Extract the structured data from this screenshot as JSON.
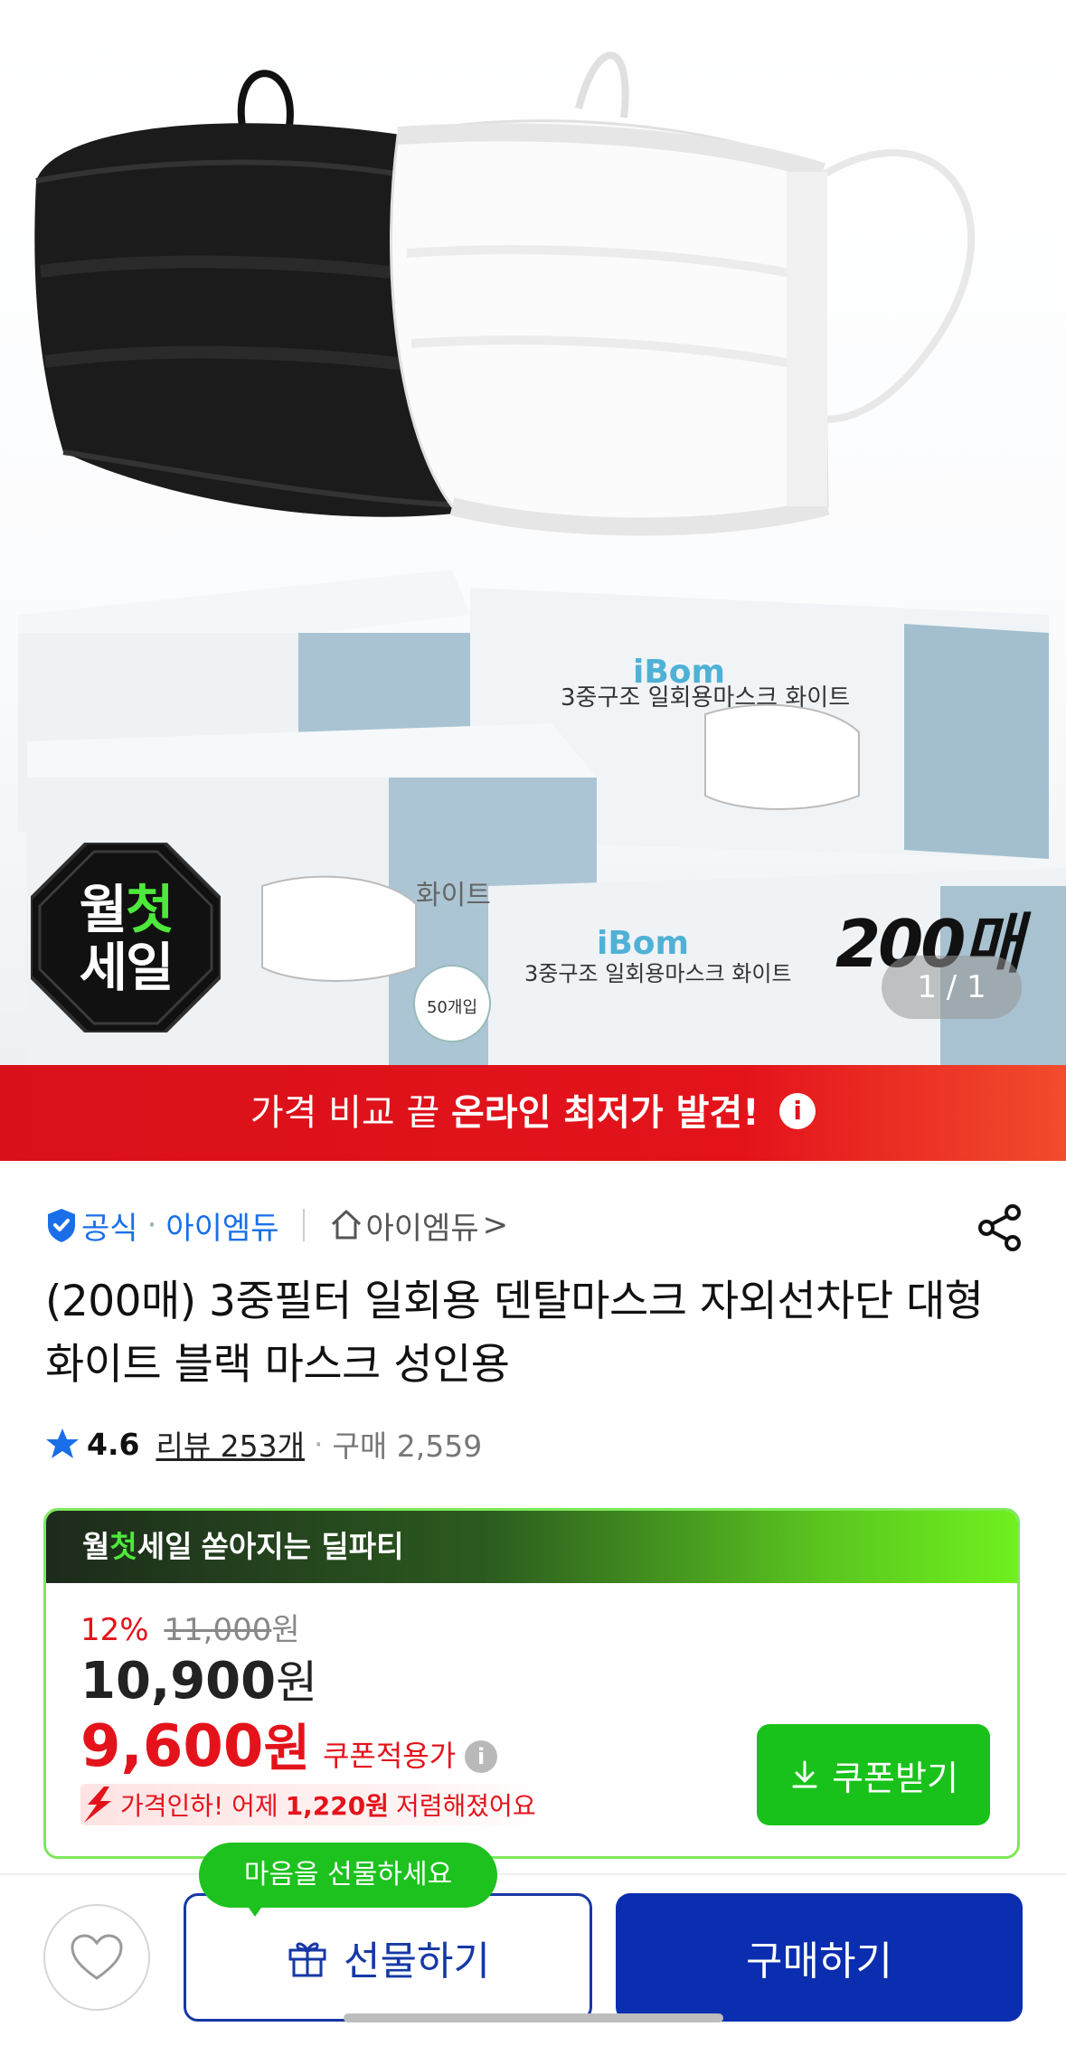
{
  "hero": {
    "sale_badge": {
      "part1": "월",
      "highlight": "첫",
      "line2": "세일"
    },
    "count_label": "200매",
    "pager": "1 / 1",
    "box_text": {
      "brand": "iBom",
      "product": "3중구조 일회용마스크 화이트",
      "count": "50개입"
    }
  },
  "banner": {
    "prefix": "가격 비교 끝",
    "bold": "온라인 최저가 발견!",
    "info_icon": "i"
  },
  "store": {
    "official_label": "공식",
    "brand": "아이엠듀",
    "shop_link": "아이엠듀",
    "shop_chevron": ">"
  },
  "product": {
    "title": "(200매) 3중필터 일회용 덴탈마스크 자외선차단 대형 화이트 블랙 마스크 성인용"
  },
  "rating": {
    "score": "4.6",
    "reviews": "리뷰 253개",
    "sold": "구매 2,559"
  },
  "deal": {
    "header_part1": "월",
    "header_highlight": "첫",
    "header_part2": "세일",
    "header_rest": "쏟아지는 딜파티",
    "discount_pct": "12%",
    "original_price": "11,000",
    "original_unit": "원",
    "price": "10,900",
    "price_unit": "원",
    "coupon_price": "9,600",
    "coupon_unit": "원",
    "coupon_label": "쿠폰적용가",
    "drop_prefix": "가격인하! 어제",
    "drop_amount": "1,220원",
    "drop_suffix": "저렴해졌어요",
    "coupon_button": "쿠폰받기"
  },
  "bottom_bar": {
    "tooltip": "마음을 선물하세요",
    "gift_button": "선물하기",
    "buy_button": "구매하기"
  },
  "colors": {
    "accent_red": "#e4131b",
    "accent_blue": "#0b2eb0",
    "accent_green": "#19c21a",
    "link_blue": "#1a6fe8"
  },
  "icons": [
    "shield-check-icon",
    "home-icon",
    "share-icon",
    "star-icon",
    "info-icon",
    "download-icon",
    "price-drop-arrow-icon",
    "heart-icon",
    "gift-icon"
  ]
}
